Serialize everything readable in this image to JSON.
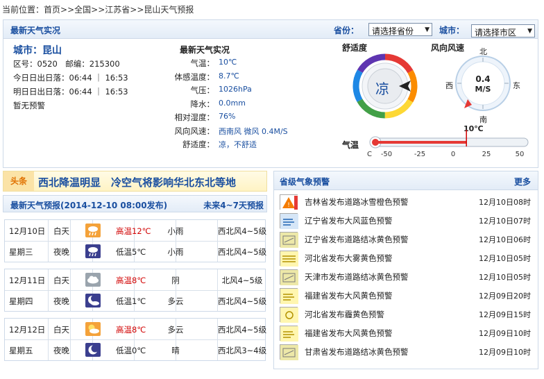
{
  "breadcrumb": {
    "prefix": "当前位置：",
    "items": [
      "首页",
      "全国",
      "江苏省",
      "昆山天气预报"
    ],
    "sep": ">>"
  },
  "current": {
    "title": "最新天气实况",
    "province_label": "省份：",
    "province_value": "请选择省份",
    "city_label": "城市：",
    "city_value": "请选择市区",
    "city_line": "城市：昆山",
    "area_code": "区号：0520　邮编：215300",
    "today_sun": "今日日出日落：06:44 ｜ 16:53",
    "tomorrow_sun": "明日日出日落：06:44 ｜ 16:53",
    "warning": "暂无预警",
    "obs_title": "最新天气实况",
    "obs": [
      {
        "label": "气温：",
        "value": "10℃"
      },
      {
        "label": "体感温度：",
        "value": "8.7℃"
      },
      {
        "label": "气压：",
        "value": "1026hPa"
      },
      {
        "label": "降水：",
        "value": "0.0mm"
      },
      {
        "label": "相对湿度：",
        "value": "76%"
      },
      {
        "label": "风向风速：",
        "value": "西南风 微风 0.4M/S"
      },
      {
        "label": "舒适度：",
        "value": "凉，不舒适"
      }
    ]
  },
  "comfort": {
    "label": "舒适度",
    "value": "凉"
  },
  "wind": {
    "label": "风向风速",
    "north": "北",
    "south": "南",
    "east": "东",
    "west": "西",
    "speed": "0.4",
    "unit": "M/S"
  },
  "temp_gauge": {
    "label": "气温",
    "current": "10℃",
    "value": 10,
    "unit": "C",
    "min": -50,
    "max": 50,
    "ticks": [
      "-50",
      "-25",
      "0",
      "25",
      "50"
    ]
  },
  "headline": {
    "tag": "头条",
    "text": "西北降温明显　冷空气将影响华北东北等地"
  },
  "forecast": {
    "title": "最新天气预报(2014-12-10 08:00发布)",
    "future": "未来4~7天预报",
    "days": [
      {
        "date": "12月10日",
        "week": "星期三",
        "day": {
          "period": "白天",
          "icon": "rain-icon",
          "temp": "高温12℃",
          "weather": "小雨",
          "wind": "西北风4~5级"
        },
        "night": {
          "period": "夜晚",
          "icon": "rain-night-icon",
          "temp": "低温5℃",
          "weather": "小雨",
          "wind": "西北风4~5级"
        }
      },
      {
        "date": "12月11日",
        "week": "星期四",
        "day": {
          "period": "白天",
          "icon": "cloud-icon",
          "temp": "高温8℃",
          "weather": "阴",
          "wind": "北风4~5级"
        },
        "night": {
          "period": "夜晚",
          "icon": "moon-cloud-icon",
          "temp": "低温1℃",
          "weather": "多云",
          "wind": "西北风4~5级"
        }
      },
      {
        "date": "12月12日",
        "week": "星期五",
        "day": {
          "period": "白天",
          "icon": "sun-cloud-icon",
          "temp": "高温8℃",
          "weather": "多云",
          "wind": "西北风4~5级"
        },
        "night": {
          "period": "夜晚",
          "icon": "moon-icon",
          "temp": "低温0℃",
          "weather": "晴",
          "wind": "西北风3~4级"
        }
      }
    ]
  },
  "alerts": {
    "title": "省级气象预警",
    "more": "更多",
    "items": [
      {
        "text": "吉林省发布道路冰雪橙色预警",
        "date": "12月10日08时",
        "icon": "road-ice-orange-icon"
      },
      {
        "text": "辽宁省发布大风蓝色预警",
        "date": "12月10日07时",
        "icon": "wind-blue-icon"
      },
      {
        "text": "辽宁省发布道路结冰黄色预警",
        "date": "12月10日06时",
        "icon": "road-ice-yellow-icon"
      },
      {
        "text": "河北省发布大雾黄色预警",
        "date": "12月10日05时",
        "icon": "fog-yellow-icon"
      },
      {
        "text": "天津市发布道路结冰黄色预警",
        "date": "12月10日05时",
        "icon": "road-ice-yellow-icon"
      },
      {
        "text": "福建省发布大风黄色预警",
        "date": "12月09日20时",
        "icon": "wind-yellow-icon"
      },
      {
        "text": "河北省发布霾黄色预警",
        "date": "12月09日15时",
        "icon": "haze-yellow-icon"
      },
      {
        "text": "福建省发布大风黄色预警",
        "date": "12月09日10时",
        "icon": "wind-yellow-icon"
      },
      {
        "text": "甘肃省发布道路结冰黄色预警",
        "date": "12月09日10时",
        "icon": "road-ice-yellow-icon"
      }
    ]
  },
  "colors": {
    "accent": "#1a4fa0",
    "hot": "#d10000",
    "headline_bg": "#fff3c4"
  }
}
